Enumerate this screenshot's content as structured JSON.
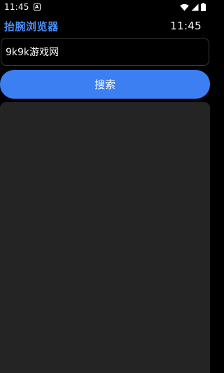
{
  "status_bar": {
    "time": "11:45",
    "app_icon": "A",
    "icons": [
      "wifi-icon",
      "signal-icon",
      "battery-icon"
    ]
  },
  "header": {
    "app_title": "抬腕浏览器",
    "clock": "11:45"
  },
  "search": {
    "value": "9k9k游戏网",
    "button_label": "搜索"
  },
  "colors": {
    "accent": "#3b7ff2",
    "title": "#4a8ef5",
    "background": "#000000",
    "panel": "#242424"
  }
}
